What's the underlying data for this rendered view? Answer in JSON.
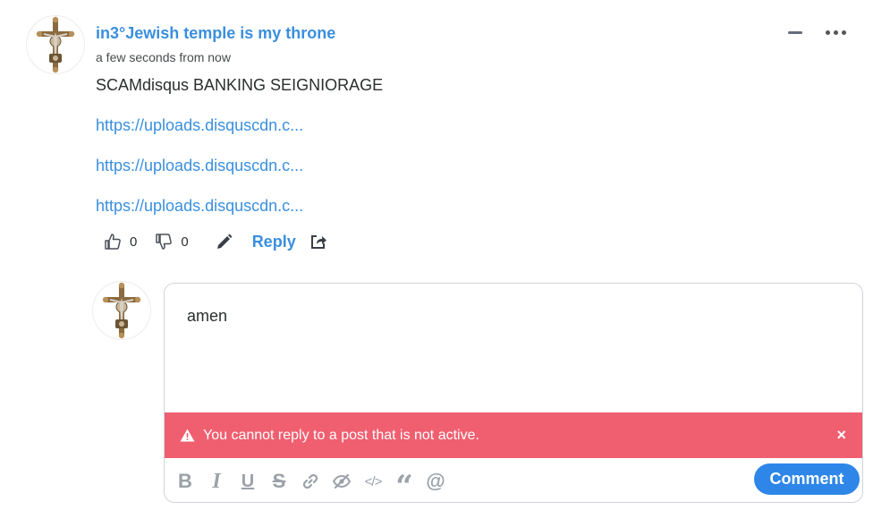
{
  "post": {
    "author": "in3°Jewish temple is my throne",
    "timestamp": "a few seconds from now",
    "lines": [
      "SCAMdisqus BANKING SEIGNIORAGE"
    ],
    "links": [
      "https://uploads.disquscdn.c...",
      "https://uploads.disquscdn.c...",
      "https://uploads.disquscdn.c..."
    ],
    "upvotes": "0",
    "downvotes": "0",
    "reply_label": "Reply"
  },
  "reply_box": {
    "text": "amen",
    "error": "You cannot reply to a post that is not active.",
    "close_glyph": "×",
    "submit_label": "Comment",
    "toolbar": [
      {
        "name": "bold-icon",
        "glyph": "B"
      },
      {
        "name": "italic-icon",
        "glyph": "I"
      },
      {
        "name": "underline-icon",
        "glyph": "U"
      },
      {
        "name": "strikethrough-icon",
        "glyph": "S"
      },
      {
        "name": "link-icon",
        "glyph": "link"
      },
      {
        "name": "spoiler-icon",
        "glyph": "eye-off"
      },
      {
        "name": "code-icon",
        "glyph": "</>"
      },
      {
        "name": "quote-icon",
        "glyph": "“"
      },
      {
        "name": "mention-icon",
        "glyph": "@"
      }
    ]
  },
  "colors": {
    "link": "#3a8fde",
    "error": "#f05f70",
    "button": "#2e86e8",
    "toolbar_icon": "#9aa1a9"
  },
  "icons": {
    "avatar": "crucifix-icon",
    "upvote": "thumbs-up-icon",
    "downvote": "thumbs-down-icon",
    "edit": "pencil-icon",
    "share": "share-icon",
    "collapse": "minus-icon",
    "more": "more-dots-icon",
    "warning": "warning-icon"
  }
}
